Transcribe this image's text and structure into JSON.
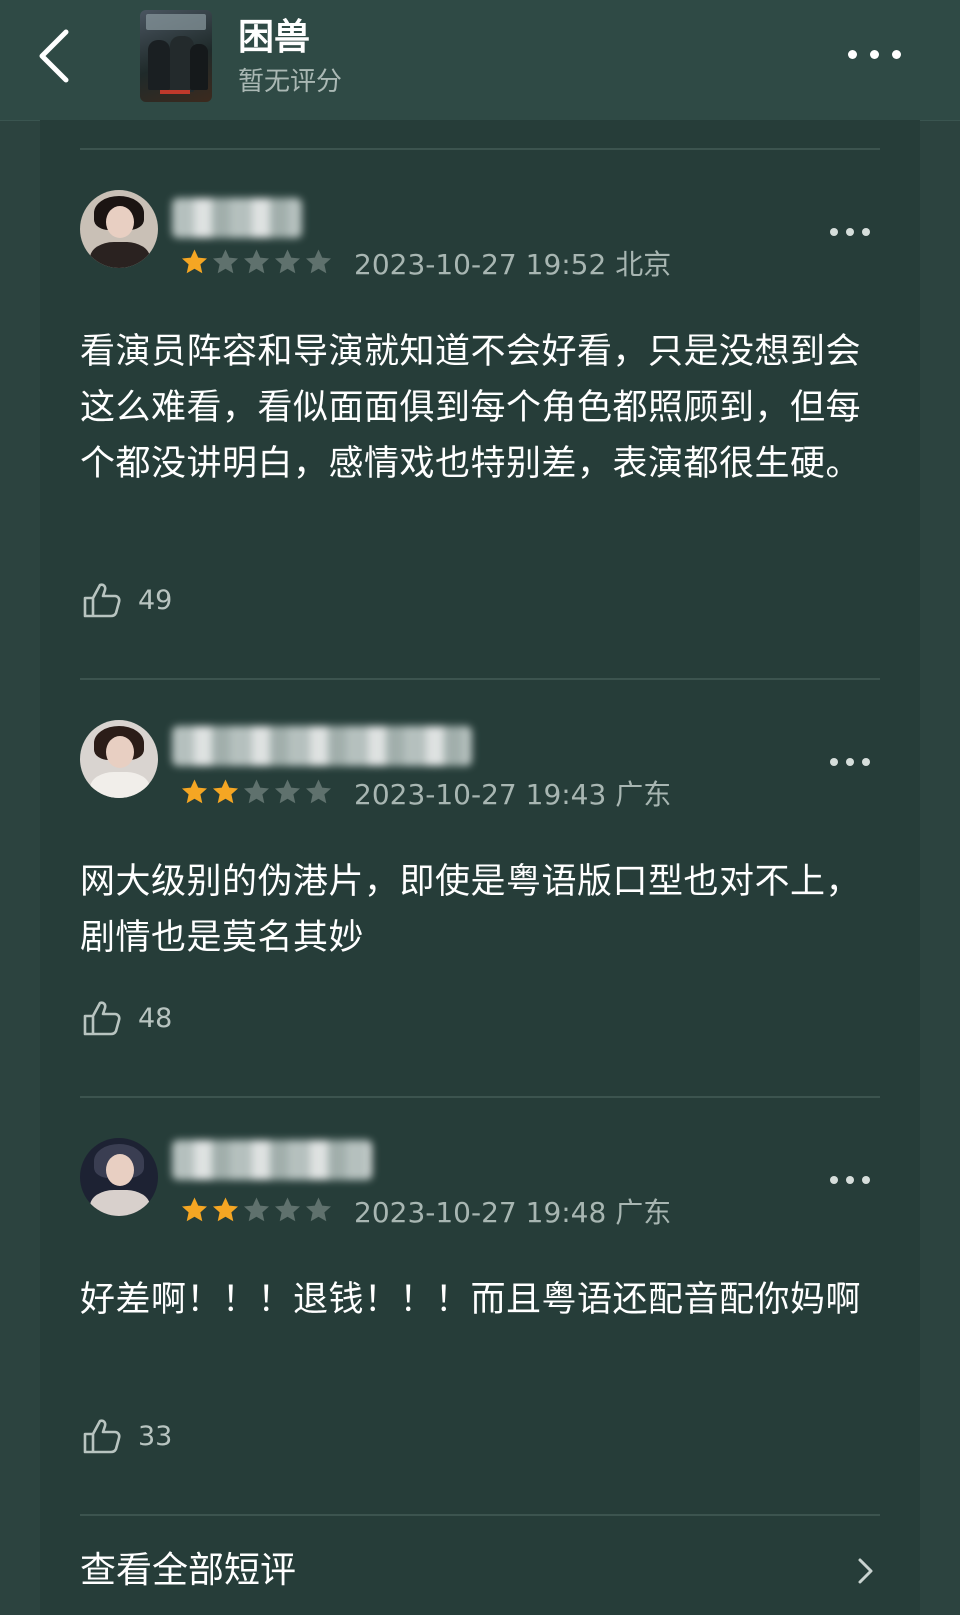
{
  "header": {
    "title": "困兽",
    "rating_text": "暂无评分"
  },
  "comments": [
    {
      "stars": 1,
      "date": "2023-10-27 19:52 北京",
      "text": "看演员阵容和导演就知道不会好看，只是没想到会这么难看，看似面面俱到每个角色都照顾到，但每个都没讲明白，感情戏也特别差，表演都很生硬。",
      "likes": "49"
    },
    {
      "stars": 2,
      "date": "2023-10-27 19:43 广东",
      "text": "网大级别的伪港片，即使是粤语版口型也对不上，剧情也是莫名其妙",
      "likes": "48"
    },
    {
      "stars": 2,
      "date": "2023-10-27 19:48 广东",
      "text": "好差啊！！！退钱！！！而且粤语还配音配你妈啊",
      "likes": "33"
    }
  ],
  "footer": {
    "view_all_label": "查看全部短评"
  },
  "colors": {
    "background": "#2c433f",
    "panel": "#263d39",
    "star_active": "#f5a623",
    "star_inactive": "#5f716d"
  }
}
